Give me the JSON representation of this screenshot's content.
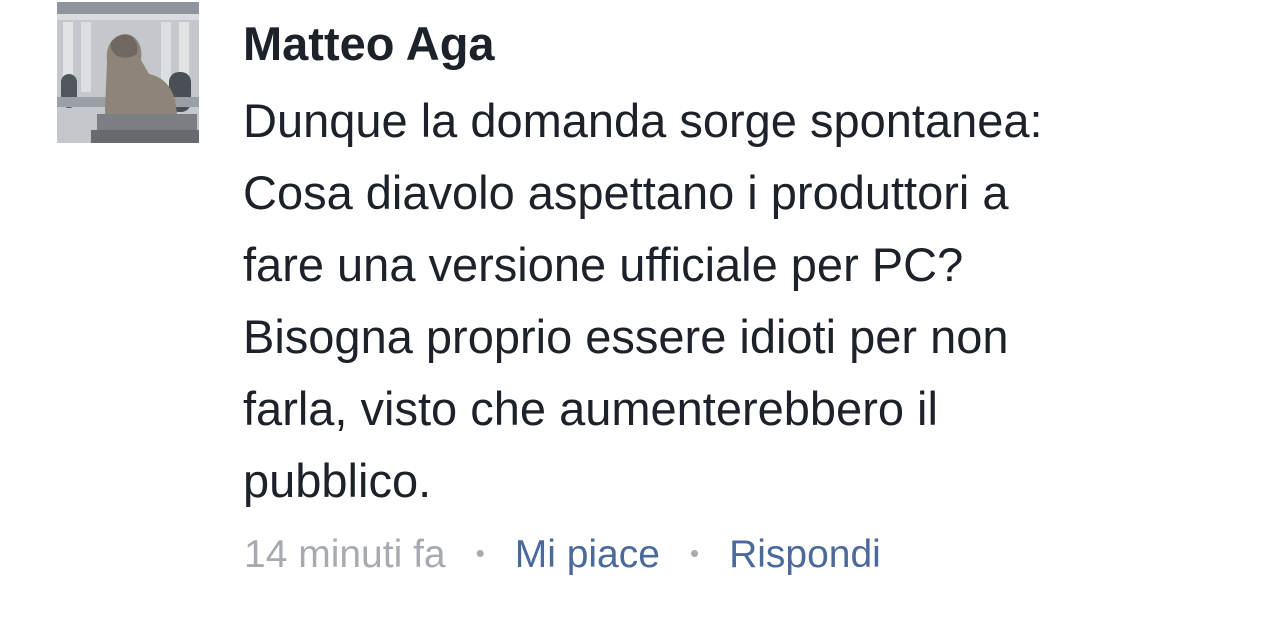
{
  "comment": {
    "avatar": "profile-photo-lion-statue",
    "author": "Matteo Aga",
    "text_lines": [
      "Dunque la domanda sorge spontanea:",
      "Cosa diavolo aspettano i produttori a",
      "fare una versione ufficiale per PC?",
      "Bisogna proprio essere idioti per non",
      "farla, visto che aumenterebbero il",
      "pubblico."
    ],
    "timestamp": "14 minuti fa",
    "separator": "•",
    "actions": {
      "like": "Mi piace",
      "reply": "Rispondi"
    }
  },
  "colors": {
    "author": "#1d2129",
    "text": "#1d2129",
    "timestamp": "#a7abb1",
    "action": "#4b6a9b"
  }
}
